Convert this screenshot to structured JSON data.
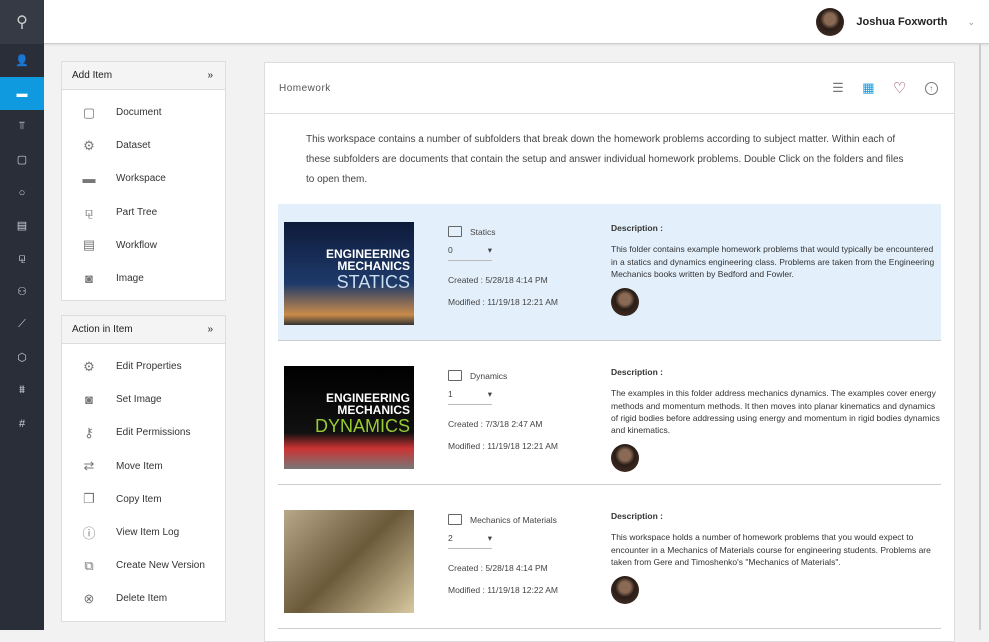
{
  "user": {
    "name": "Joshua Foxworth"
  },
  "nav": [
    "user-icon",
    "folder-icon",
    "signpost-icon",
    "document-icon",
    "circle-icon",
    "calendar-icon",
    "hierarchy-icon",
    "group-icon",
    "chart-icon",
    "cube-icon",
    "mask-icon",
    "hash-icon"
  ],
  "add_panel": {
    "title": "Add Item",
    "items": [
      {
        "label": "Document",
        "icon": "document-icon"
      },
      {
        "label": "Dataset",
        "icon": "gear-icon"
      },
      {
        "label": "Workspace",
        "icon": "folder-icon"
      },
      {
        "label": "Part Tree",
        "icon": "hierarchy-icon"
      },
      {
        "label": "Workflow",
        "icon": "workflow-icon"
      },
      {
        "label": "Image",
        "icon": "camera-icon"
      }
    ]
  },
  "action_panel": {
    "title": "Action in Item",
    "items": [
      {
        "label": "Edit Properties",
        "icon": "gear-icon"
      },
      {
        "label": "Set Image",
        "icon": "camera-icon"
      },
      {
        "label": "Edit Permissions",
        "icon": "key-icon"
      },
      {
        "label": "Move Item",
        "icon": "sync-icon"
      },
      {
        "label": "Copy Item",
        "icon": "copy-icon"
      },
      {
        "label": "View Item Log",
        "icon": "info-icon"
      },
      {
        "label": "Create New Version",
        "icon": "version-icon"
      },
      {
        "label": "Delete Item",
        "icon": "delete-icon"
      }
    ]
  },
  "main": {
    "title": "Homework",
    "intro": "This workspace contains a number of subfolders that break down the homework problems according to subject matter. Within each of these subfolders are documents that contain the setup and answer individual homework problems. Double Click on the folders and files to open them.",
    "desc_label": "Description :",
    "items": [
      {
        "name": "Statics",
        "version": "0",
        "created": "Created : 5/28/18 4:14 PM",
        "modified": "Modified : 11/19/18 12:21 AM",
        "description": "This folder contains example homework problems that would typically be encountered in a statics and dynamics engineering class. Problems are taken from the Engineering Mechanics books written by Bedford and Fowler.",
        "cover": [
          "ENGINEERING",
          "MECHANICS",
          "STATICS"
        ]
      },
      {
        "name": "Dynamics",
        "version": "1",
        "created": "Created : 7/3/18 2:47 AM",
        "modified": "Modified : 11/19/18 12:21 AM",
        "description": "The examples in this folder address mechanics dynamics. The examples cover energy methods and momentum methods. It then moves into planar kinematics and dynamics of rigid bodies before addressing using energy and momentum in rigid bodies dynamics and kinematics.",
        "cover": [
          "ENGINEERING",
          "MECHANICS",
          "DYNAMICS"
        ]
      },
      {
        "name": "Mechanics of Materials",
        "version": "2",
        "created": "Created : 5/28/18 4:14 PM",
        "modified": "Modified : 11/19/18 12:22 AM",
        "description": "This workspace holds a number of homework problems that you would expect to encounter in a Mechanics of Materials course for engineering students. Problems are taken from Gere and Timoshenko's \"Mechanics of Materials\".",
        "cover": []
      }
    ]
  },
  "colors": {
    "accent": "#0f9ae0",
    "selected_row": "#e3f0fb",
    "heart": "#7a1f3a"
  }
}
